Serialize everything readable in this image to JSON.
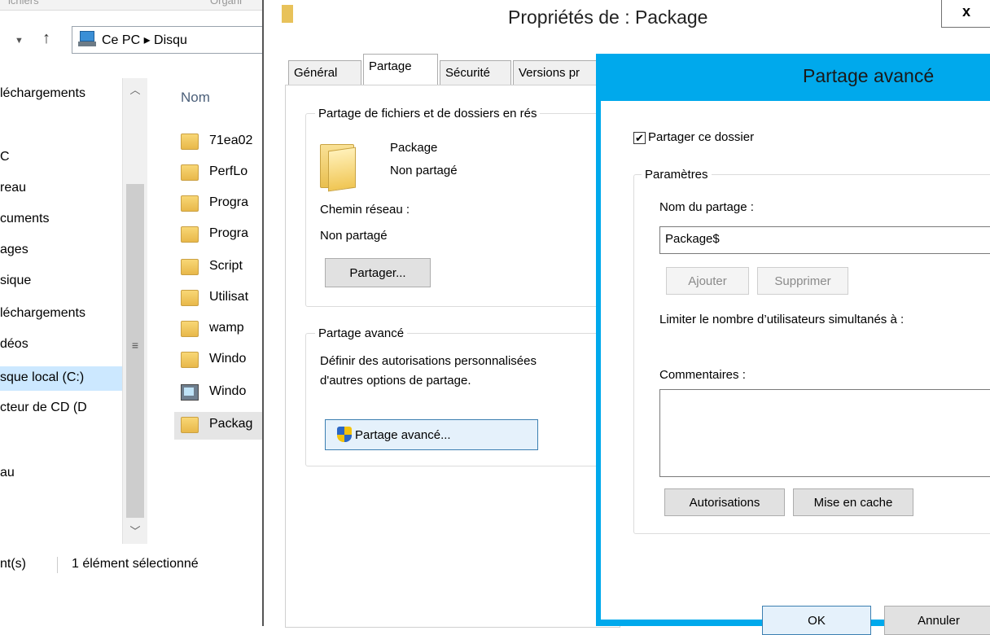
{
  "explorer": {
    "ribbon_left": "ichiers",
    "ribbon_right": "Organi",
    "address": "Ce PC ▸ Disqu",
    "nav_tree": [
      "léchargements",
      "C",
      "reau",
      "cuments",
      "ages",
      "sique",
      "léchargements",
      "déos",
      "sque local (C:)",
      "cteur de CD (D",
      "au"
    ],
    "column_header": "Nom",
    "files": [
      "71ea02",
      "PerfLo",
      "Progra",
      "Progra",
      "Script",
      "Utilisat",
      "wamp",
      "Windo",
      "Windo",
      "Packag"
    ],
    "status_left": "nt(s)",
    "status_selected": "1 élément sélectionné"
  },
  "properties": {
    "title": "Propriétés de : Package",
    "close_glyph": "x",
    "tabs": [
      "Général",
      "Partage",
      "Sécurité",
      "Versions pr"
    ],
    "file_sharing_group": "Partage de fichiers et de dossiers en rés",
    "folder_name": "Package",
    "share_status": "Non partagé",
    "network_path_label": "Chemin réseau :",
    "network_path_value": "Non partagé",
    "share_button": "Partager...",
    "advanced_group": "Partage avancé",
    "advanced_desc_1": "Définir des autorisations personnalisées",
    "advanced_desc_2": "d'autres options de partage.",
    "advanced_button": "Partage avancé..."
  },
  "advanced": {
    "title": "Partage avancé",
    "share_checkbox": "Partager ce dossier",
    "share_checked": true,
    "params_group": "Paramètres",
    "share_name_label": "Nom du partage :",
    "share_name_value": "Package$",
    "add_button": "Ajouter",
    "remove_button": "Supprimer",
    "limit_label": "Limiter le nombre d’utilisateurs simultanés à :",
    "comments_label": "Commentaires :",
    "permissions_button": "Autorisations",
    "caching_button": "Mise en cache",
    "ok_button": "OK",
    "cancel_button": "Annuler"
  },
  "colors": {
    "dialog_accent": "#00a9ec",
    "selection": "#cce8ff",
    "folder": "#f0c654"
  }
}
